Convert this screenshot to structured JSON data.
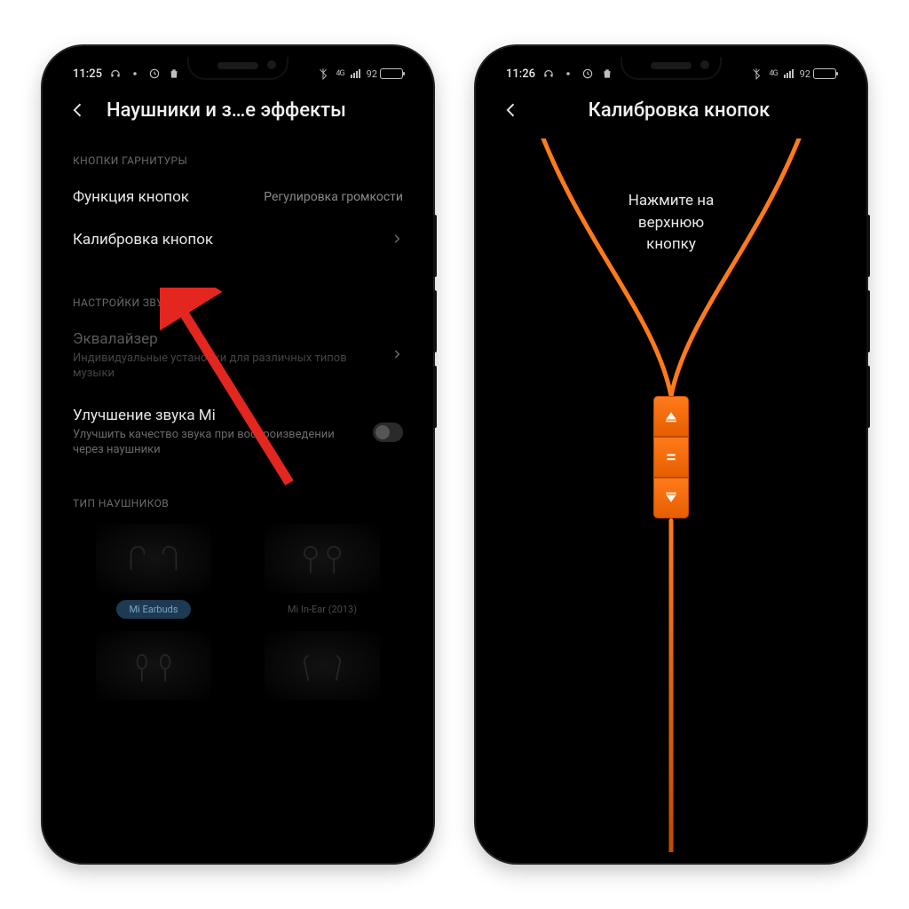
{
  "phone1": {
    "status": {
      "time": "11:25",
      "battery": "92",
      "network": "4G"
    },
    "title": "Наушники и з…е эффекты",
    "section_buttons": "КНОПКИ ГАРНИТУРЫ",
    "row_func": {
      "label": "Функция кнопок",
      "value": "Регулировка громкости"
    },
    "row_calib": {
      "label": "Калибровка кнопок"
    },
    "section_sound": "НАСТРОЙКИ ЗВУКА",
    "row_eq": {
      "label": "Эквалайзер",
      "sub": "Индивидуальные установки для различных типов музыки"
    },
    "row_mi": {
      "label": "Улучшение звука Mi",
      "sub": "Улучшить качество звука при воспроизведении через наушники"
    },
    "section_type": "ТИП НАУШНИКОВ",
    "hp": [
      {
        "name": "Mi Earbuds",
        "selected": true
      },
      {
        "name": "Mi In-Ear (2013)",
        "selected": false
      },
      {
        "name": "",
        "selected": false
      },
      {
        "name": "",
        "selected": false
      }
    ]
  },
  "phone2": {
    "status": {
      "time": "11:26",
      "battery": "92",
      "network": "4G"
    },
    "title": "Калибровка кнопок",
    "instruction": "Нажмите на\nверхнюю\nкнопку"
  },
  "colors": {
    "accent": "#ff6a00",
    "arrow": "#e3261f"
  }
}
